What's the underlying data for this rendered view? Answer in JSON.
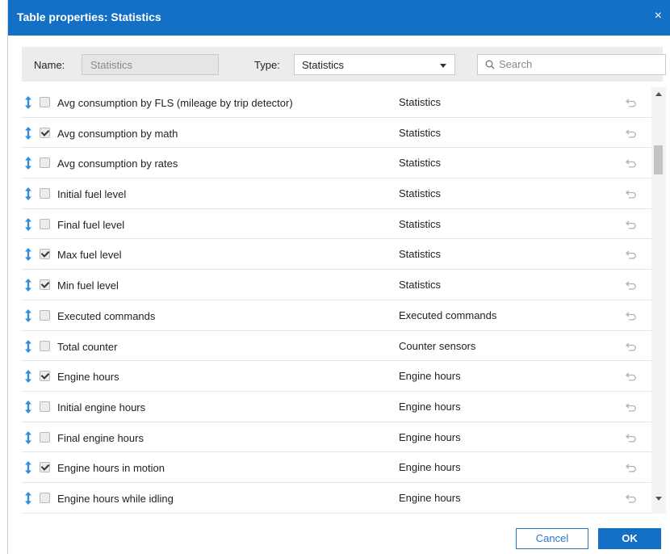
{
  "dialog": {
    "title": "Table properties: Statistics",
    "close_icon": "×"
  },
  "filter": {
    "name_label": "Name:",
    "name_value": "Statistics",
    "type_label": "Type:",
    "type_value": "Statistics",
    "search_placeholder": "Search"
  },
  "rows": [
    {
      "label": "Avg consumption by FLS (mileage by trip detector)",
      "type": "Statistics",
      "checked": false
    },
    {
      "label": "Avg consumption by math",
      "type": "Statistics",
      "checked": true
    },
    {
      "label": "Avg consumption by rates",
      "type": "Statistics",
      "checked": false
    },
    {
      "label": "Initial fuel level",
      "type": "Statistics",
      "checked": false
    },
    {
      "label": "Final fuel level",
      "type": "Statistics",
      "checked": false
    },
    {
      "label": "Max fuel level",
      "type": "Statistics",
      "checked": true
    },
    {
      "label": "Min fuel level",
      "type": "Statistics",
      "checked": true
    },
    {
      "label": "Executed commands",
      "type": "Executed commands",
      "checked": false
    },
    {
      "label": "Total counter",
      "type": "Counter sensors",
      "checked": false
    },
    {
      "label": "Engine hours",
      "type": "Engine hours",
      "checked": true
    },
    {
      "label": "Initial engine hours",
      "type": "Engine hours",
      "checked": false
    },
    {
      "label": "Final engine hours",
      "type": "Engine hours",
      "checked": false
    },
    {
      "label": "Engine hours in motion",
      "type": "Engine hours",
      "checked": true
    },
    {
      "label": "Engine hours while idling",
      "type": "Engine hours",
      "checked": false
    }
  ],
  "buttons": {
    "cancel": "Cancel",
    "ok": "OK"
  },
  "colors": {
    "accent": "#1370c4",
    "drag_icon": "#2d8ee0",
    "reset_icon": "#b0b0b0"
  },
  "icons": {
    "row_drag": "vertical-resize-arrow-icon",
    "row_reset": "undo-arrow-icon",
    "search": "magnifier-icon"
  }
}
